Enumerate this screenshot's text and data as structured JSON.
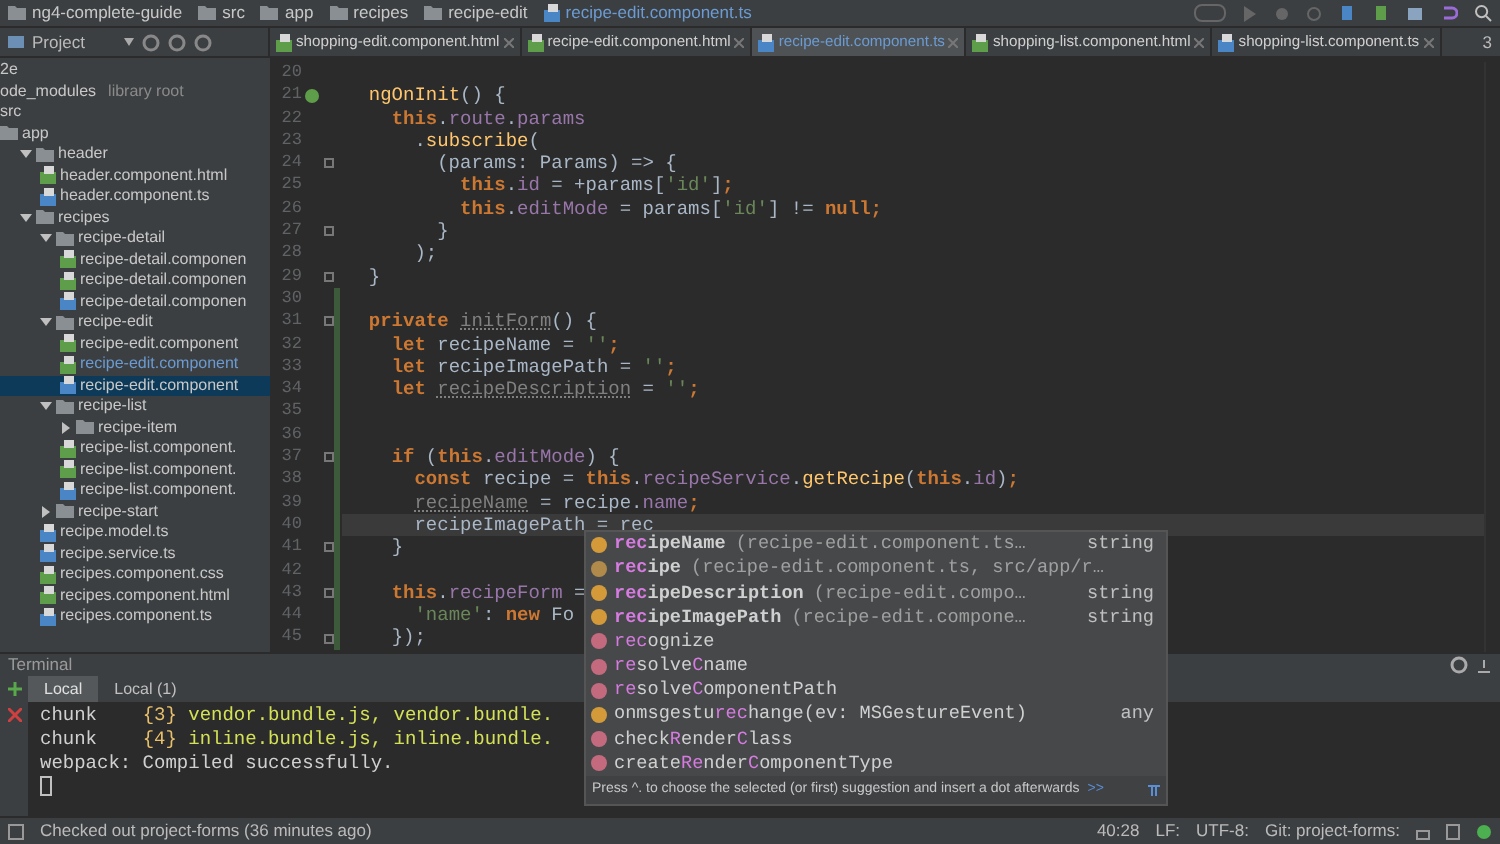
{
  "breadcrumbs": [
    {
      "label": "ng4-complete-guide",
      "kind": "folder"
    },
    {
      "label": "src",
      "kind": "folder"
    },
    {
      "label": "app",
      "kind": "folder"
    },
    {
      "label": "recipes",
      "kind": "folder"
    },
    {
      "label": "recipe-edit",
      "kind": "folder"
    },
    {
      "label": "recipe-edit.component.ts",
      "kind": "ts"
    }
  ],
  "project_pane": {
    "title": "Project"
  },
  "tabs": [
    {
      "label": "shopping-edit.component.html",
      "kind": "html",
      "selected": false
    },
    {
      "label": "recipe-edit.component.html",
      "kind": "html",
      "selected": false
    },
    {
      "label": "recipe-edit.component.ts",
      "kind": "ts",
      "selected": true
    },
    {
      "label": "shopping-list.component.html",
      "kind": "html",
      "selected": false
    },
    {
      "label": "shopping-list.component.ts",
      "kind": "ts",
      "selected": false
    }
  ],
  "tabs_overflow": "3",
  "sidebar": {
    "items": [
      {
        "label": "2e",
        "kind": "none",
        "selected": false
      },
      {
        "label": "ode_modules",
        "note": "library root",
        "kind": "none",
        "selected": false
      },
      {
        "label": "src",
        "kind": "none",
        "selected": false
      },
      {
        "label": "app",
        "kind": "folder",
        "selected": false,
        "children": [
          {
            "label": "header",
            "kind": "folder",
            "expanded": true,
            "selected": false,
            "children": [
              {
                "label": "header.component.html",
                "kind": "html",
                "selected": false
              },
              {
                "label": "header.component.ts",
                "kind": "ts",
                "selected": false
              }
            ]
          },
          {
            "label": "recipes",
            "kind": "folder",
            "expanded": true,
            "selected": false,
            "children": [
              {
                "label": "recipe-detail",
                "kind": "folder",
                "expanded": true,
                "selected": false,
                "children": [
                  {
                    "label": "recipe-detail.componen",
                    "kind": "css",
                    "selected": false
                  },
                  {
                    "label": "recipe-detail.componen",
                    "kind": "html",
                    "selected": false
                  },
                  {
                    "label": "recipe-detail.componen",
                    "kind": "ts",
                    "selected": false
                  }
                ]
              },
              {
                "label": "recipe-edit",
                "kind": "folder",
                "expanded": true,
                "selected": false,
                "children": [
                  {
                    "label": "recipe-edit.component",
                    "kind": "css",
                    "selected": false
                  },
                  {
                    "label": "recipe-edit.component",
                    "kind": "html",
                    "open": true,
                    "selected": false
                  },
                  {
                    "label": "recipe-edit.component",
                    "kind": "ts",
                    "selected": true
                  }
                ]
              },
              {
                "label": "recipe-list",
                "kind": "folder",
                "expanded": true,
                "selected": false,
                "children": [
                  {
                    "label": "recipe-item",
                    "kind": "folder",
                    "expanded": false,
                    "selected": false
                  },
                  {
                    "label": "recipe-list.component.",
                    "kind": "css",
                    "selected": false
                  },
                  {
                    "label": "recipe-list.component.",
                    "kind": "html",
                    "selected": false
                  },
                  {
                    "label": "recipe-list.component.",
                    "kind": "ts",
                    "selected": false
                  }
                ]
              },
              {
                "label": "recipe-start",
                "kind": "folder",
                "expanded": false,
                "selected": false
              },
              {
                "label": "recipe.model.ts",
                "kind": "ts",
                "selected": false
              },
              {
                "label": "recipe.service.ts",
                "kind": "ts",
                "selected": false
              },
              {
                "label": "recipes.component.css",
                "kind": "css",
                "selected": false
              },
              {
                "label": "recipes.component.html",
                "kind": "html",
                "selected": false
              },
              {
                "label": "recipes.component.ts",
                "kind": "ts",
                "selected": false
              }
            ]
          }
        ]
      }
    ]
  },
  "editor": {
    "lines": [
      {
        "n": "20",
        "changed": false,
        "fold": false,
        "current": false,
        "override": false
      },
      {
        "n": "21",
        "tokens": [
          {
            "t": "  ngOnInit",
            "kind": "fn"
          },
          {
            "t": "() {",
            "kind": "plain"
          }
        ],
        "changed": false,
        "fold": false,
        "current": false,
        "override": true
      },
      {
        "n": "22",
        "tokens": [
          {
            "t": "    this",
            "kind": "kw"
          },
          {
            "t": ".",
            "kind": "plain"
          },
          {
            "t": "route",
            "kind": "prop"
          },
          {
            "t": ".",
            "kind": "plain"
          },
          {
            "t": "params",
            "kind": "prop"
          }
        ],
        "changed": false,
        "fold": false,
        "current": false,
        "override": false
      },
      {
        "n": "23",
        "tokens": [
          {
            "t": "      .",
            "kind": "plain"
          },
          {
            "t": "subscribe",
            "kind": "fn"
          },
          {
            "t": "(",
            "kind": "plain"
          }
        ],
        "changed": false,
        "fold": false,
        "current": false,
        "override": false
      },
      {
        "n": "24",
        "tokens": [
          {
            "t": "        (params: Params) => {",
            "kind": "plain"
          }
        ],
        "changed": false,
        "fold": true,
        "current": false,
        "override": false
      },
      {
        "n": "25",
        "tokens": [
          {
            "t": "          this",
            "kind": "kw"
          },
          {
            "t": ".",
            "kind": "plain"
          },
          {
            "t": "id",
            "kind": "prop"
          },
          {
            "t": " = +params[",
            "kind": "plain"
          },
          {
            "t": "'id'",
            "kind": "str"
          },
          {
            "t": "]",
            "kind": "plain"
          },
          {
            "t": ";",
            "kind": "kw"
          }
        ],
        "changed": false,
        "fold": false,
        "current": false,
        "override": false
      },
      {
        "n": "26",
        "tokens": [
          {
            "t": "          this",
            "kind": "kw"
          },
          {
            "t": ".",
            "kind": "plain"
          },
          {
            "t": "editMode",
            "kind": "prop"
          },
          {
            "t": " = params[",
            "kind": "plain"
          },
          {
            "t": "'id'",
            "kind": "str"
          },
          {
            "t": "] != ",
            "kind": "plain"
          },
          {
            "t": "null;",
            "kind": "kw"
          }
        ],
        "changed": false,
        "fold": false,
        "current": false,
        "override": false
      },
      {
        "n": "27",
        "tokens": [
          {
            "t": "        }",
            "kind": "plain"
          }
        ],
        "changed": false,
        "fold": true,
        "current": false,
        "override": false
      },
      {
        "n": "28",
        "tokens": [
          {
            "t": "      );",
            "kind": "plain"
          }
        ],
        "changed": false,
        "fold": false,
        "current": false,
        "override": false
      },
      {
        "n": "29",
        "tokens": [
          {
            "t": "  }",
            "kind": "plain"
          }
        ],
        "changed": false,
        "fold": true,
        "current": false,
        "override": false
      },
      {
        "n": "30",
        "changed": true,
        "fold": false,
        "current": false,
        "override": false
      },
      {
        "n": "31",
        "tokens": [
          {
            "t": "  private",
            "kind": "kw"
          },
          {
            "t": " initForm",
            "kind": "unused"
          },
          {
            "t": "() {",
            "kind": "plain"
          }
        ],
        "changed": true,
        "fold": true,
        "current": false,
        "override": false
      },
      {
        "n": "32",
        "tokens": [
          {
            "t": "    let",
            "kind": "kw"
          },
          {
            "t": " recipeName = ",
            "kind": "plain"
          },
          {
            "t": "''",
            "kind": "str"
          },
          {
            "t": ";",
            "kind": "kw"
          }
        ],
        "changed": true,
        "fold": false,
        "current": false,
        "override": false
      },
      {
        "n": "33",
        "tokens": [
          {
            "t": "    let",
            "kind": "kw"
          },
          {
            "t": " recipeImagePath = ",
            "kind": "plain"
          },
          {
            "t": "''",
            "kind": "str"
          },
          {
            "t": ";",
            "kind": "kw"
          }
        ],
        "changed": true,
        "fold": false,
        "current": false,
        "override": false
      },
      {
        "n": "34",
        "tokens": [
          {
            "t": "    let",
            "kind": "kw"
          },
          {
            "t": " recipeDescription",
            "kind": "unused"
          },
          {
            "t": " = ",
            "kind": "plain"
          },
          {
            "t": "''",
            "kind": "str"
          },
          {
            "t": ";",
            "kind": "kw"
          }
        ],
        "changed": true,
        "fold": false,
        "current": false,
        "override": false
      },
      {
        "n": "35",
        "changed": true,
        "fold": false,
        "current": false,
        "override": false
      },
      {
        "n": "36",
        "changed": true,
        "fold": false,
        "current": false,
        "override": false
      },
      {
        "n": "37",
        "tokens": [
          {
            "t": "    if",
            "kind": "kw"
          },
          {
            "t": " (",
            "kind": "plain"
          },
          {
            "t": "this",
            "kind": "kw"
          },
          {
            "t": ".",
            "kind": "plain"
          },
          {
            "t": "editMode",
            "kind": "prop"
          },
          {
            "t": ") {",
            "kind": "plain"
          }
        ],
        "changed": true,
        "fold": true,
        "current": false,
        "override": false
      },
      {
        "n": "38",
        "tokens": [
          {
            "t": "      const",
            "kind": "kw"
          },
          {
            "t": " recipe = ",
            "kind": "plain"
          },
          {
            "t": "this",
            "kind": "kw"
          },
          {
            "t": ".",
            "kind": "plain"
          },
          {
            "t": "recipeService",
            "kind": "prop"
          },
          {
            "t": ".",
            "kind": "plain"
          },
          {
            "t": "getRecipe",
            "kind": "fn"
          },
          {
            "t": "(",
            "kind": "plain"
          },
          {
            "t": "this",
            "kind": "kw"
          },
          {
            "t": ".",
            "kind": "plain"
          },
          {
            "t": "id",
            "kind": "prop"
          },
          {
            "t": ")",
            "kind": "plain"
          },
          {
            "t": ";",
            "kind": "kw"
          }
        ],
        "changed": true,
        "fold": false,
        "current": false,
        "override": false
      },
      {
        "n": "39",
        "tokens": [
          {
            "t": "      recipeName",
            "kind": "unused"
          },
          {
            "t": " = recipe.",
            "kind": "plain"
          },
          {
            "t": "name",
            "kind": "prop"
          },
          {
            "t": ";",
            "kind": "kw"
          }
        ],
        "changed": true,
        "fold": false,
        "current": false,
        "override": false
      },
      {
        "n": "40",
        "tokens": [
          {
            "t": "      recipeImagePath = rec",
            "kind": "plain"
          }
        ],
        "changed": true,
        "fold": false,
        "current": true,
        "override": false
      },
      {
        "n": "41",
        "tokens": [
          {
            "t": "    }",
            "kind": "plain"
          }
        ],
        "changed": true,
        "fold": true,
        "current": false,
        "override": false
      },
      {
        "n": "42",
        "changed": true,
        "fold": false,
        "current": false,
        "override": false
      },
      {
        "n": "43",
        "tokens": [
          {
            "t": "    this",
            "kind": "kw"
          },
          {
            "t": ".",
            "kind": "plain"
          },
          {
            "t": "recipeForm",
            "kind": "prop"
          },
          {
            "t": " =",
            "kind": "plain"
          }
        ],
        "changed": true,
        "fold": true,
        "current": false,
        "override": false
      },
      {
        "n": "44",
        "tokens": [
          {
            "t": "      'name'",
            "kind": "str"
          },
          {
            "t": ": ",
            "kind": "plain"
          },
          {
            "t": "new",
            "kind": "kw"
          },
          {
            "t": " Fo",
            "kind": "plain"
          }
        ],
        "changed": true,
        "fold": false,
        "current": false,
        "override": false
      },
      {
        "n": "45",
        "tokens": [
          {
            "t": "    });",
            "kind": "plain"
          }
        ],
        "changed": true,
        "fold": true,
        "current": false,
        "override": false
      }
    ]
  },
  "completion": {
    "items": [
      {
        "kind": "field",
        "bold": true,
        "parts": [
          {
            "t": "rec",
            "matched": true
          },
          {
            "t": "ipeName",
            "matched": false
          }
        ],
        "detail": "(recipe-edit.component.ts…",
        "type": "string"
      },
      {
        "kind": "variable",
        "bold": true,
        "parts": [
          {
            "t": "rec",
            "matched": true
          },
          {
            "t": "ipe",
            "matched": false
          }
        ],
        "detail": "(recipe-edit.component.ts, src/app/r…"
      },
      {
        "kind": "field",
        "bold": true,
        "parts": [
          {
            "t": "rec",
            "matched": true
          },
          {
            "t": "ipeDescription",
            "matched": false
          }
        ],
        "detail": "(recipe-edit.compo…",
        "type": "string"
      },
      {
        "kind": "field",
        "bold": true,
        "parts": [
          {
            "t": "rec",
            "matched": true
          },
          {
            "t": "ipeImagePath",
            "matched": false
          }
        ],
        "detail": "(recipe-edit.compone…",
        "type": "string"
      },
      {
        "kind": "method",
        "bold": false,
        "parts": [
          {
            "t": "rec",
            "matched": true
          },
          {
            "t": "ognize",
            "matched": false
          }
        ]
      },
      {
        "kind": "method",
        "bold": false,
        "parts": [
          {
            "t": "re",
            "matched": true
          },
          {
            "t": "solve",
            "matched": false
          },
          {
            "t": "C",
            "matched": true
          },
          {
            "t": "name",
            "matched": false
          }
        ]
      },
      {
        "kind": "method",
        "bold": false,
        "parts": [
          {
            "t": "re",
            "matched": true
          },
          {
            "t": "solve",
            "matched": false
          },
          {
            "t": "C",
            "matched": true
          },
          {
            "t": "omponentPath",
            "matched": false
          }
        ]
      },
      {
        "kind": "field",
        "bold": false,
        "parts": [
          {
            "t": "onmsgestu",
            "matched": false
          },
          {
            "t": "rec",
            "matched": true
          },
          {
            "t": "hange(ev: MSGestureEvent)",
            "matched": false
          }
        ],
        "type": "any"
      },
      {
        "kind": "method",
        "bold": false,
        "parts": [
          {
            "t": "check",
            "matched": false
          },
          {
            "t": "R",
            "matched": true
          },
          {
            "t": "ender",
            "matched": false
          },
          {
            "t": "C",
            "matched": true
          },
          {
            "t": "lass",
            "matched": false
          }
        ]
      },
      {
        "kind": "method",
        "bold": false,
        "parts": [
          {
            "t": "create",
            "matched": false
          },
          {
            "t": "Re",
            "matched": true
          },
          {
            "t": "nder",
            "matched": false
          },
          {
            "t": "C",
            "matched": true
          },
          {
            "t": "omponentType",
            "matched": false
          }
        ]
      }
    ],
    "hint": "Press ^. to choose the selected (or first) suggestion and insert a dot afterwards",
    "hint_link": ">>"
  },
  "terminal": {
    "title": "Terminal",
    "tabs": [
      {
        "label": "Local",
        "selected": true
      },
      {
        "label": "Local (1)",
        "selected": false
      }
    ],
    "lines": [
      [
        {
          "t": "chunk    ",
          "kind": "plain"
        },
        {
          "t": "{3}",
          "kind": "num"
        },
        {
          "t": " vendor.bundle.js, vendor.bundle.",
          "kind": "file"
        }
      ],
      [
        {
          "t": "chunk    ",
          "kind": "plain"
        },
        {
          "t": "{4}",
          "kind": "num"
        },
        {
          "t": " inline.bundle.js, inline.bundle.",
          "kind": "file"
        }
      ],
      [
        {
          "t": "webpack: Compiled successfully.",
          "kind": "plain"
        }
      ]
    ]
  },
  "status_bar": {
    "message": "Checked out project-forms (36 minutes ago)",
    "items": [
      "40:28",
      "LF:",
      "UTF-8:",
      "Git: project-forms:"
    ]
  }
}
